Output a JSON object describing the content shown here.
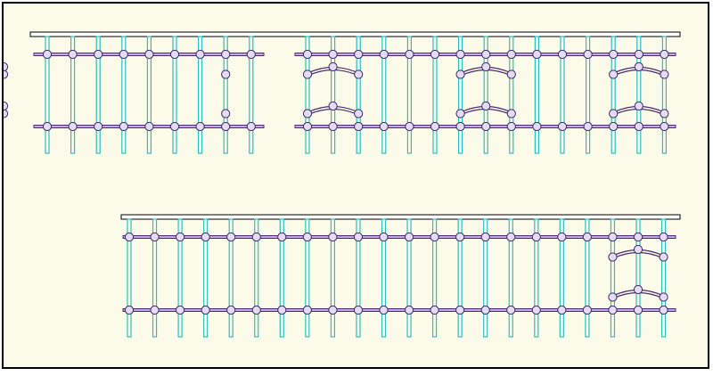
{
  "colors": {
    "background": "#fcfbea",
    "frame_border": "#000000",
    "top_rail_fill": "#ffffff",
    "top_rail_stroke": "#000000",
    "post_stroke": "#2bbfc0",
    "crossbar_stroke": "#4a2d6f",
    "crossbar_fill": "#c9a6e6",
    "node_stroke": "#3a2a60",
    "node_fill": "#e6dbf6",
    "arc_stroke": "#4a2d6f",
    "arc_fill": "#c9a6e6"
  },
  "icons": {
    "post": "vertical-post-icon",
    "node": "circle-node-icon",
    "arch": "arch-brace-icon"
  },
  "fence_top": {
    "left_section": {
      "post_count": 9,
      "arch_bays": [
        [
          7,
          9
        ]
      ]
    },
    "right_section": {
      "post_count": 15,
      "arch_bays": [
        [
          0,
          2
        ],
        [
          6,
          8
        ],
        [
          12,
          14
        ]
      ]
    }
  },
  "fence_bottom": {
    "post_count": 22,
    "arch_bays": [
      [
        19,
        21
      ]
    ]
  }
}
